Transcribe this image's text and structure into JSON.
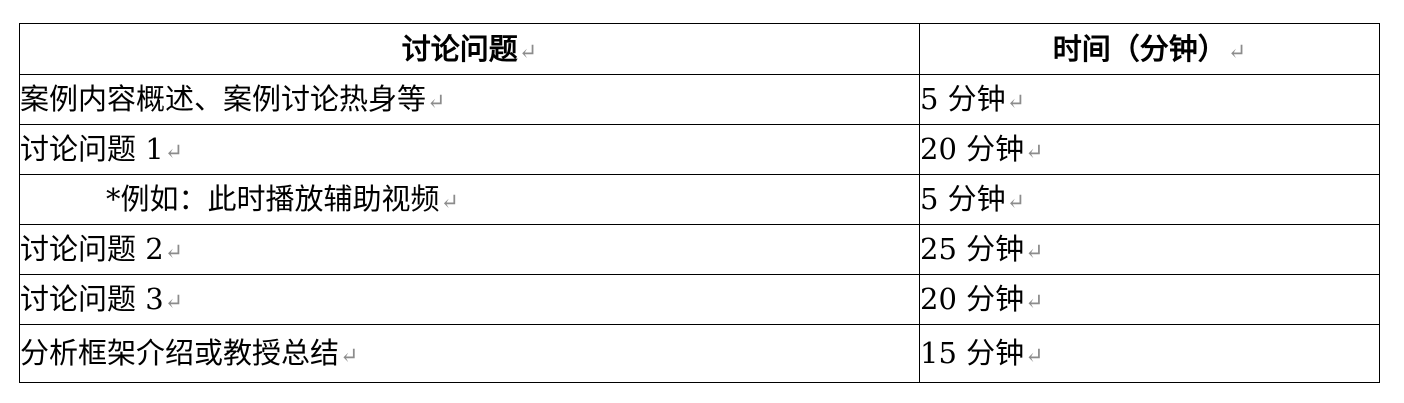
{
  "table": {
    "header": {
      "topic": "讨论问题",
      "duration": "时间（分钟）"
    },
    "paragraph_mark": "↵",
    "rows": [
      {
        "topic": "案例内容概述、案例讨论热身等",
        "duration": "5 分钟"
      },
      {
        "topic": "讨论问题 1",
        "duration": "20 分钟"
      },
      {
        "topic": "*例如：此时播放辅助视频",
        "duration": "5 分钟"
      },
      {
        "topic": "讨论问题 2",
        "duration": "25 分钟"
      },
      {
        "topic": "讨论问题 3",
        "duration": "20 分钟"
      },
      {
        "topic": "分析框架介绍或教授总结",
        "duration": "15 分钟"
      }
    ]
  }
}
